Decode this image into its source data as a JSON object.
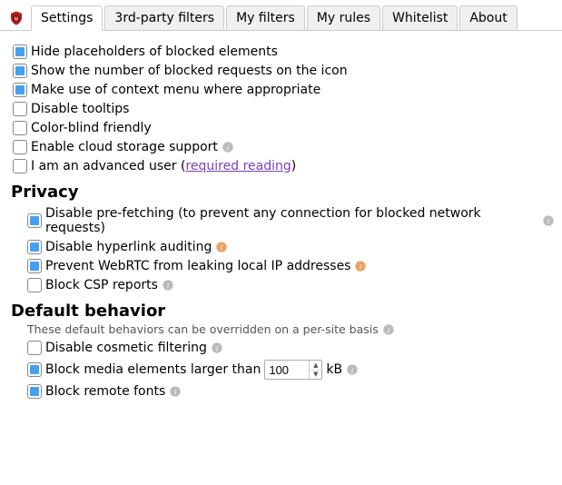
{
  "tabs": {
    "t0": "Settings",
    "t1": "3rd-party filters",
    "t2": "My filters",
    "t3": "My rules",
    "t4": "Whitelist",
    "t5": "About"
  },
  "settings": {
    "hide_placeholders": "Hide placeholders of blocked elements",
    "show_count": "Show the number of blocked requests on the icon",
    "context_menu": "Make use of context menu where appropriate",
    "disable_tooltips": "Disable tooltips",
    "color_blind": "Color-blind friendly",
    "cloud_storage": "Enable cloud storage support",
    "advanced_pre": "I am an advanced user (",
    "advanced_link": "required reading",
    "advanced_post": ")"
  },
  "privacy": {
    "heading": "Privacy",
    "prefetch": "Disable pre-fetching (to prevent any connection for blocked network requests)",
    "hyperlink": "Disable hyperlink auditing",
    "webrtc": "Prevent WebRTC from leaking local IP addresses",
    "csp": "Block CSP reports"
  },
  "default": {
    "heading": "Default behavior",
    "note": "These default behaviors can be overridden on a per-site basis",
    "cosmetic": "Disable cosmetic filtering",
    "media_pre": "Block media elements larger than",
    "media_value": "100",
    "media_unit": "kB",
    "remote_fonts": "Block remote fonts"
  }
}
